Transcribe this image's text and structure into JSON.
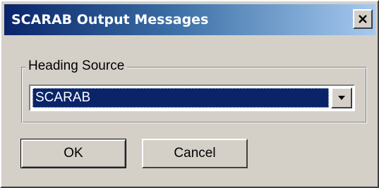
{
  "window": {
    "title": "SCARAB Output Messages",
    "close_icon": "close-x"
  },
  "heading_source": {
    "label": "Heading Source",
    "selected_value": "SCARAB",
    "dropdown_icon": "chevron-down"
  },
  "buttons": {
    "ok_label": "OK",
    "cancel_label": "Cancel"
  },
  "colors": {
    "titlebar_start": "#0a246a",
    "titlebar_end": "#a6caf0",
    "selection": "#0a246a",
    "face": "#d4d0c8"
  }
}
